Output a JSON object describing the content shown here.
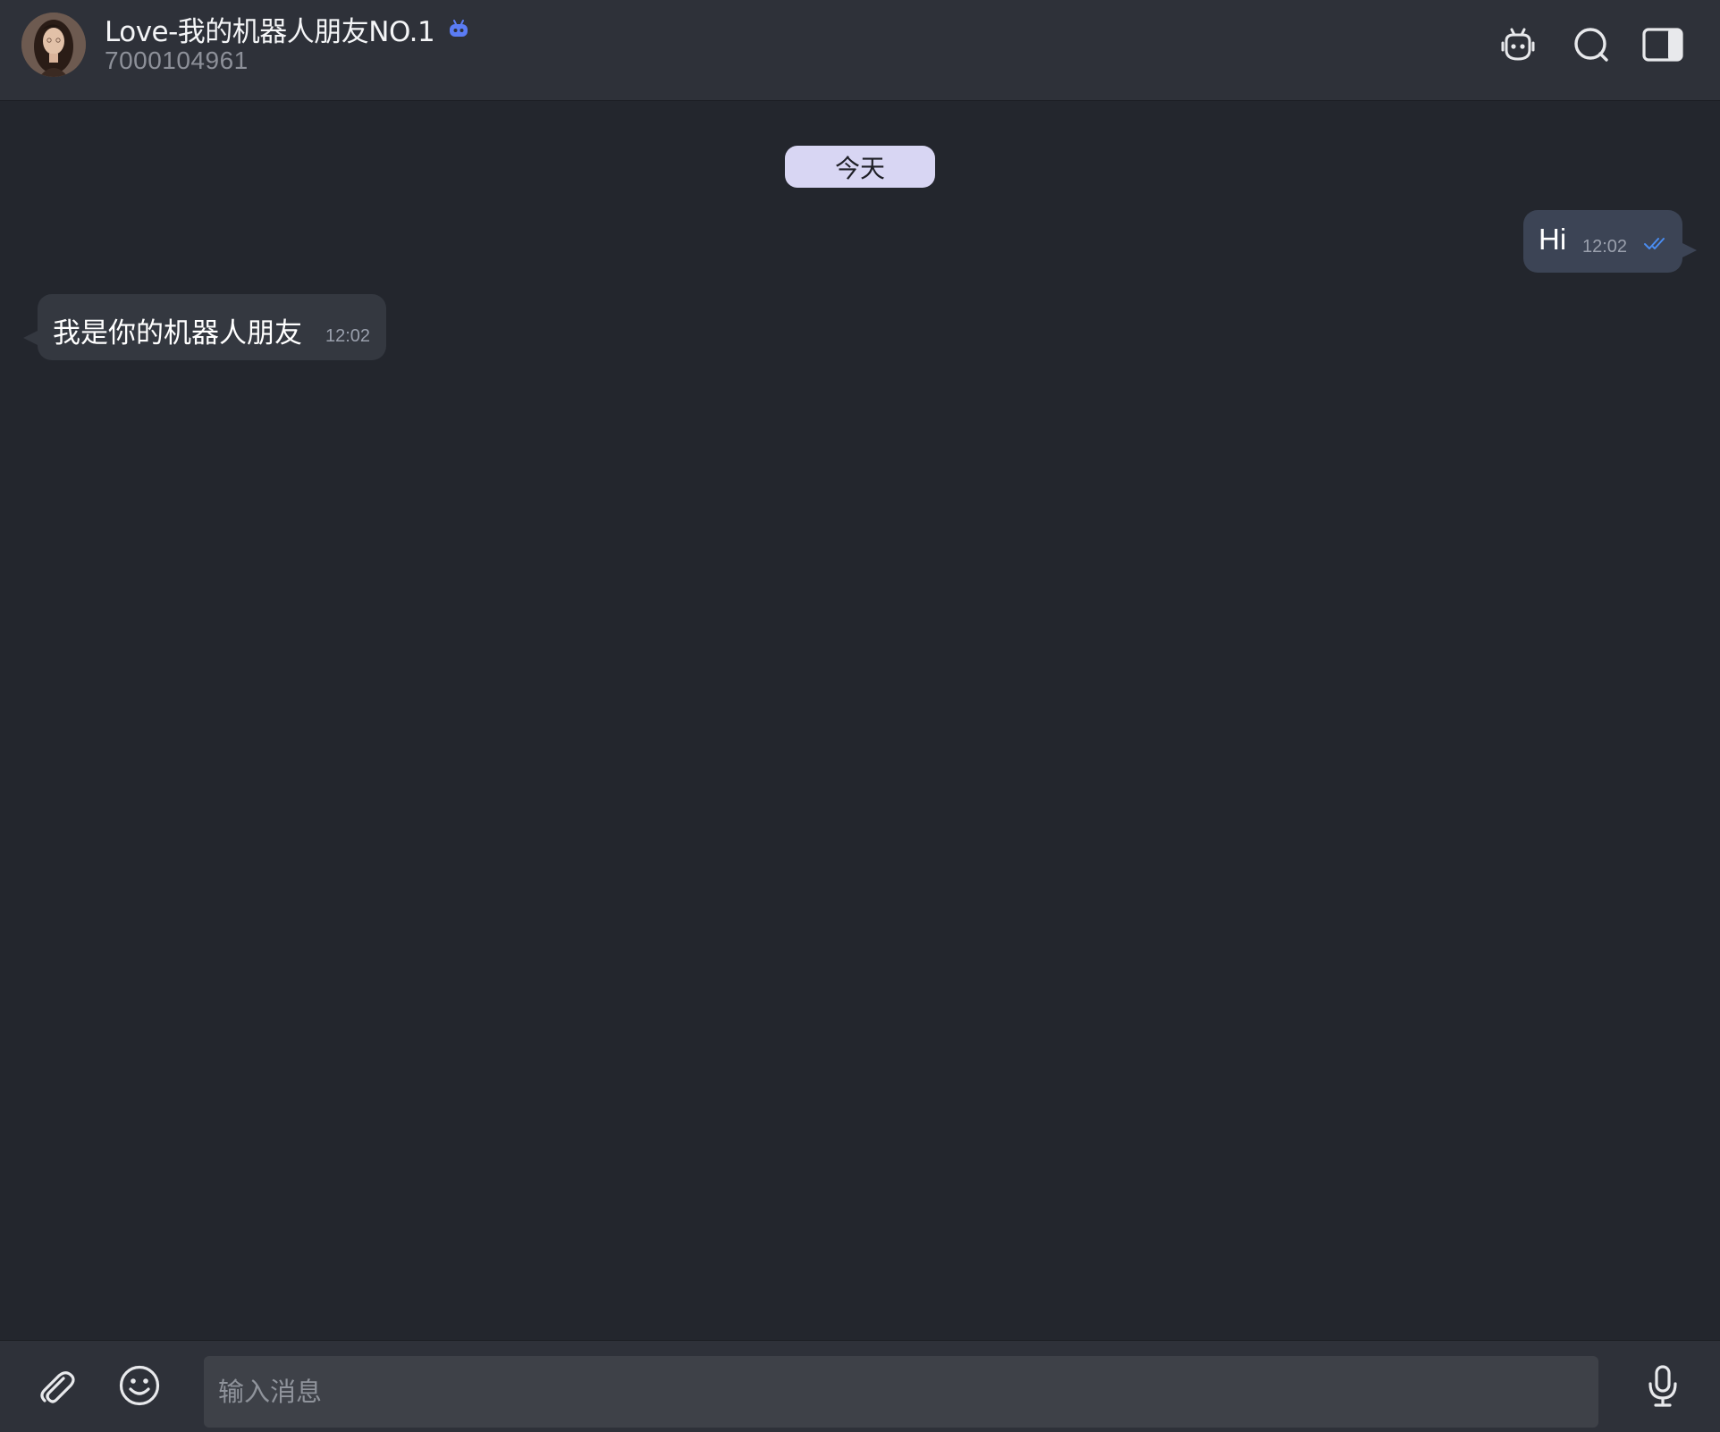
{
  "header": {
    "title": "Love-我的机器人朋友NO.1",
    "subtitle": "7000104961",
    "avatar_icon": "avatar-photo",
    "badge_icon": "bot-icon",
    "actions": [
      {
        "icon": "bot-icon"
      },
      {
        "icon": "search-icon"
      },
      {
        "icon": "sidebar-panel-icon"
      }
    ]
  },
  "chat": {
    "date_divider": "今天",
    "messages": [
      {
        "direction": "outgoing",
        "text": "Hi",
        "time": "12:02",
        "status": "read"
      },
      {
        "direction": "incoming",
        "text": "我是你的机器人朋友",
        "time": "12:02"
      }
    ]
  },
  "composer": {
    "placeholder": "输入消息",
    "value": "",
    "attach_icon": "paperclip-icon",
    "emoji_icon": "emoji-icon",
    "mic_icon": "microphone-icon"
  },
  "colors": {
    "header_bg": "#2e3139",
    "chat_bg": "#23262d",
    "outgoing_bubble": "#3c4455",
    "incoming_bubble": "#343840",
    "date_pill": "#d8d6f3",
    "badge_accent": "#5b7cf5",
    "read_check": "#4a8cf0"
  }
}
